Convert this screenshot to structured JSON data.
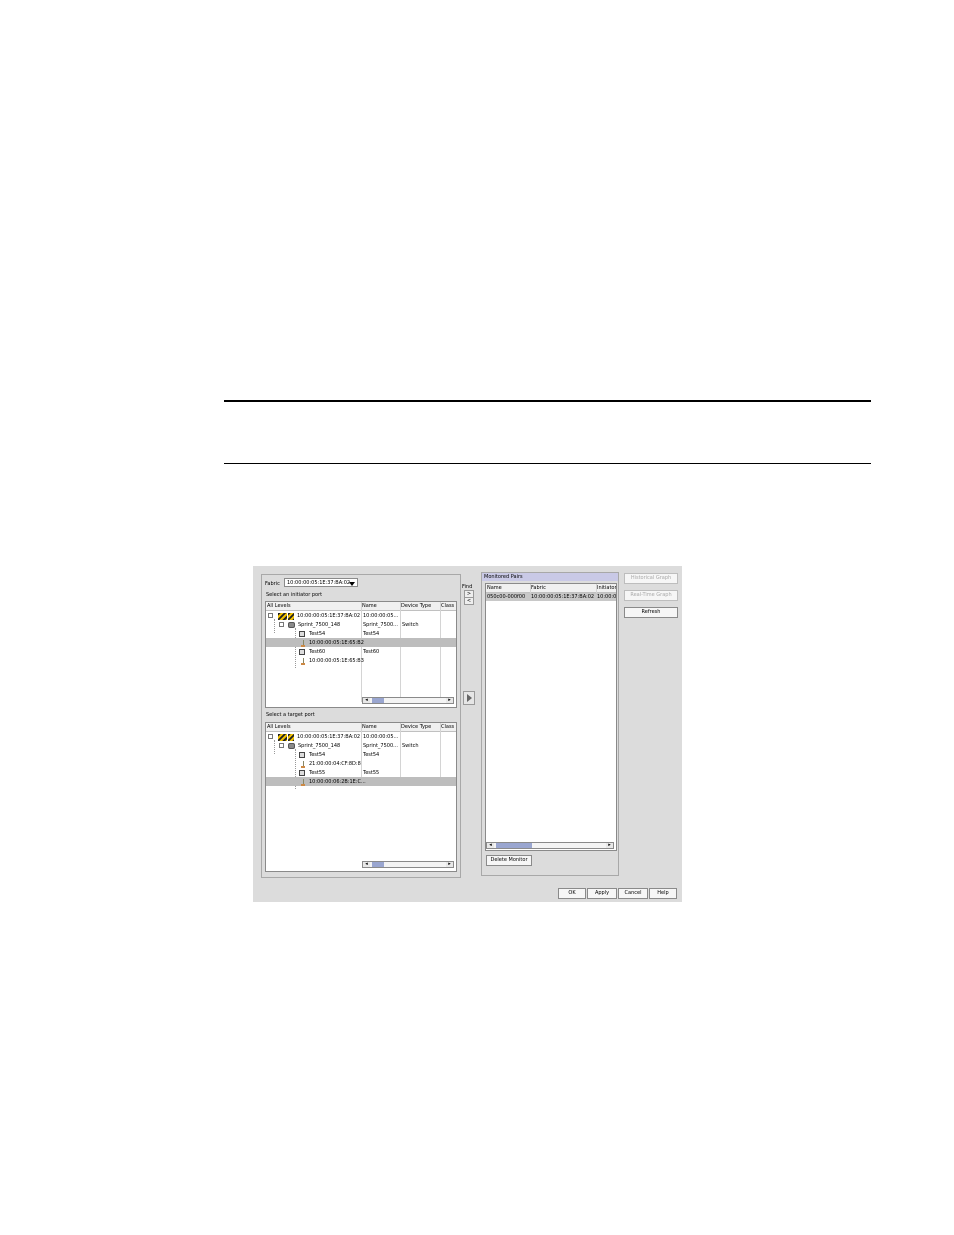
{
  "dialog": {
    "fabric_label": "Fabric",
    "fabric_value": "10:00:00:05:1E:37:BA:02",
    "initiator_title": "Select an initiator port",
    "target_title": "Select a target port",
    "columns": [
      "All Levels",
      "Name",
      "Device Type",
      "Class"
    ],
    "initiator_rows": [
      {
        "level": "10:00:00:05:1E:37:BA:02",
        "name": "10:00:00:05...",
        "type": ""
      },
      {
        "level": "Sprint_7500_148",
        "name": "Sprint_7500...",
        "type": "Switch"
      },
      {
        "level": "Test54",
        "name": "Test54",
        "type": ""
      },
      {
        "level": "10:00:00:05:1E:65:B2",
        "name": "",
        "type": ""
      },
      {
        "level": "Test60",
        "name": "Test60",
        "type": ""
      },
      {
        "level": "10:00:00:05:1E:65:B3",
        "name": "",
        "type": ""
      }
    ],
    "target_rows": [
      {
        "level": "10:00:00:05:1E:37:BA:02",
        "name": "10:00:00:05...",
        "type": ""
      },
      {
        "level": "Sprint_7500_148",
        "name": "Sprint_7500...",
        "type": "Switch"
      },
      {
        "level": "Test54",
        "name": "Test54",
        "type": ""
      },
      {
        "level": "21:00:00:04:CF:8D:8",
        "name": "",
        "type": ""
      },
      {
        "level": "Test55",
        "name": "Test55",
        "type": ""
      },
      {
        "level": "10:00:00:06:2B:1E:C...",
        "name": "",
        "type": ""
      }
    ],
    "find_label": "Find",
    "find_next": ">",
    "find_prev": "<",
    "monitored_title": "Monitored Pairs",
    "monitored_columns": [
      "Name",
      "Fabric",
      "Initiator"
    ],
    "monitored_rows": [
      {
        "name": "050c00-000f00",
        "fabric": "10:00:00:05:1E:37:BA:02",
        "initiator": "10:00:0"
      }
    ],
    "buttons": {
      "historical_graph": "Historical Graph",
      "realtime_graph": "Real-Time Graph",
      "refresh": "Refresh",
      "delete_monitor": "Delete Monitor",
      "ok": "OK",
      "apply": "Apply",
      "cancel": "Cancel",
      "help": "Help"
    }
  }
}
